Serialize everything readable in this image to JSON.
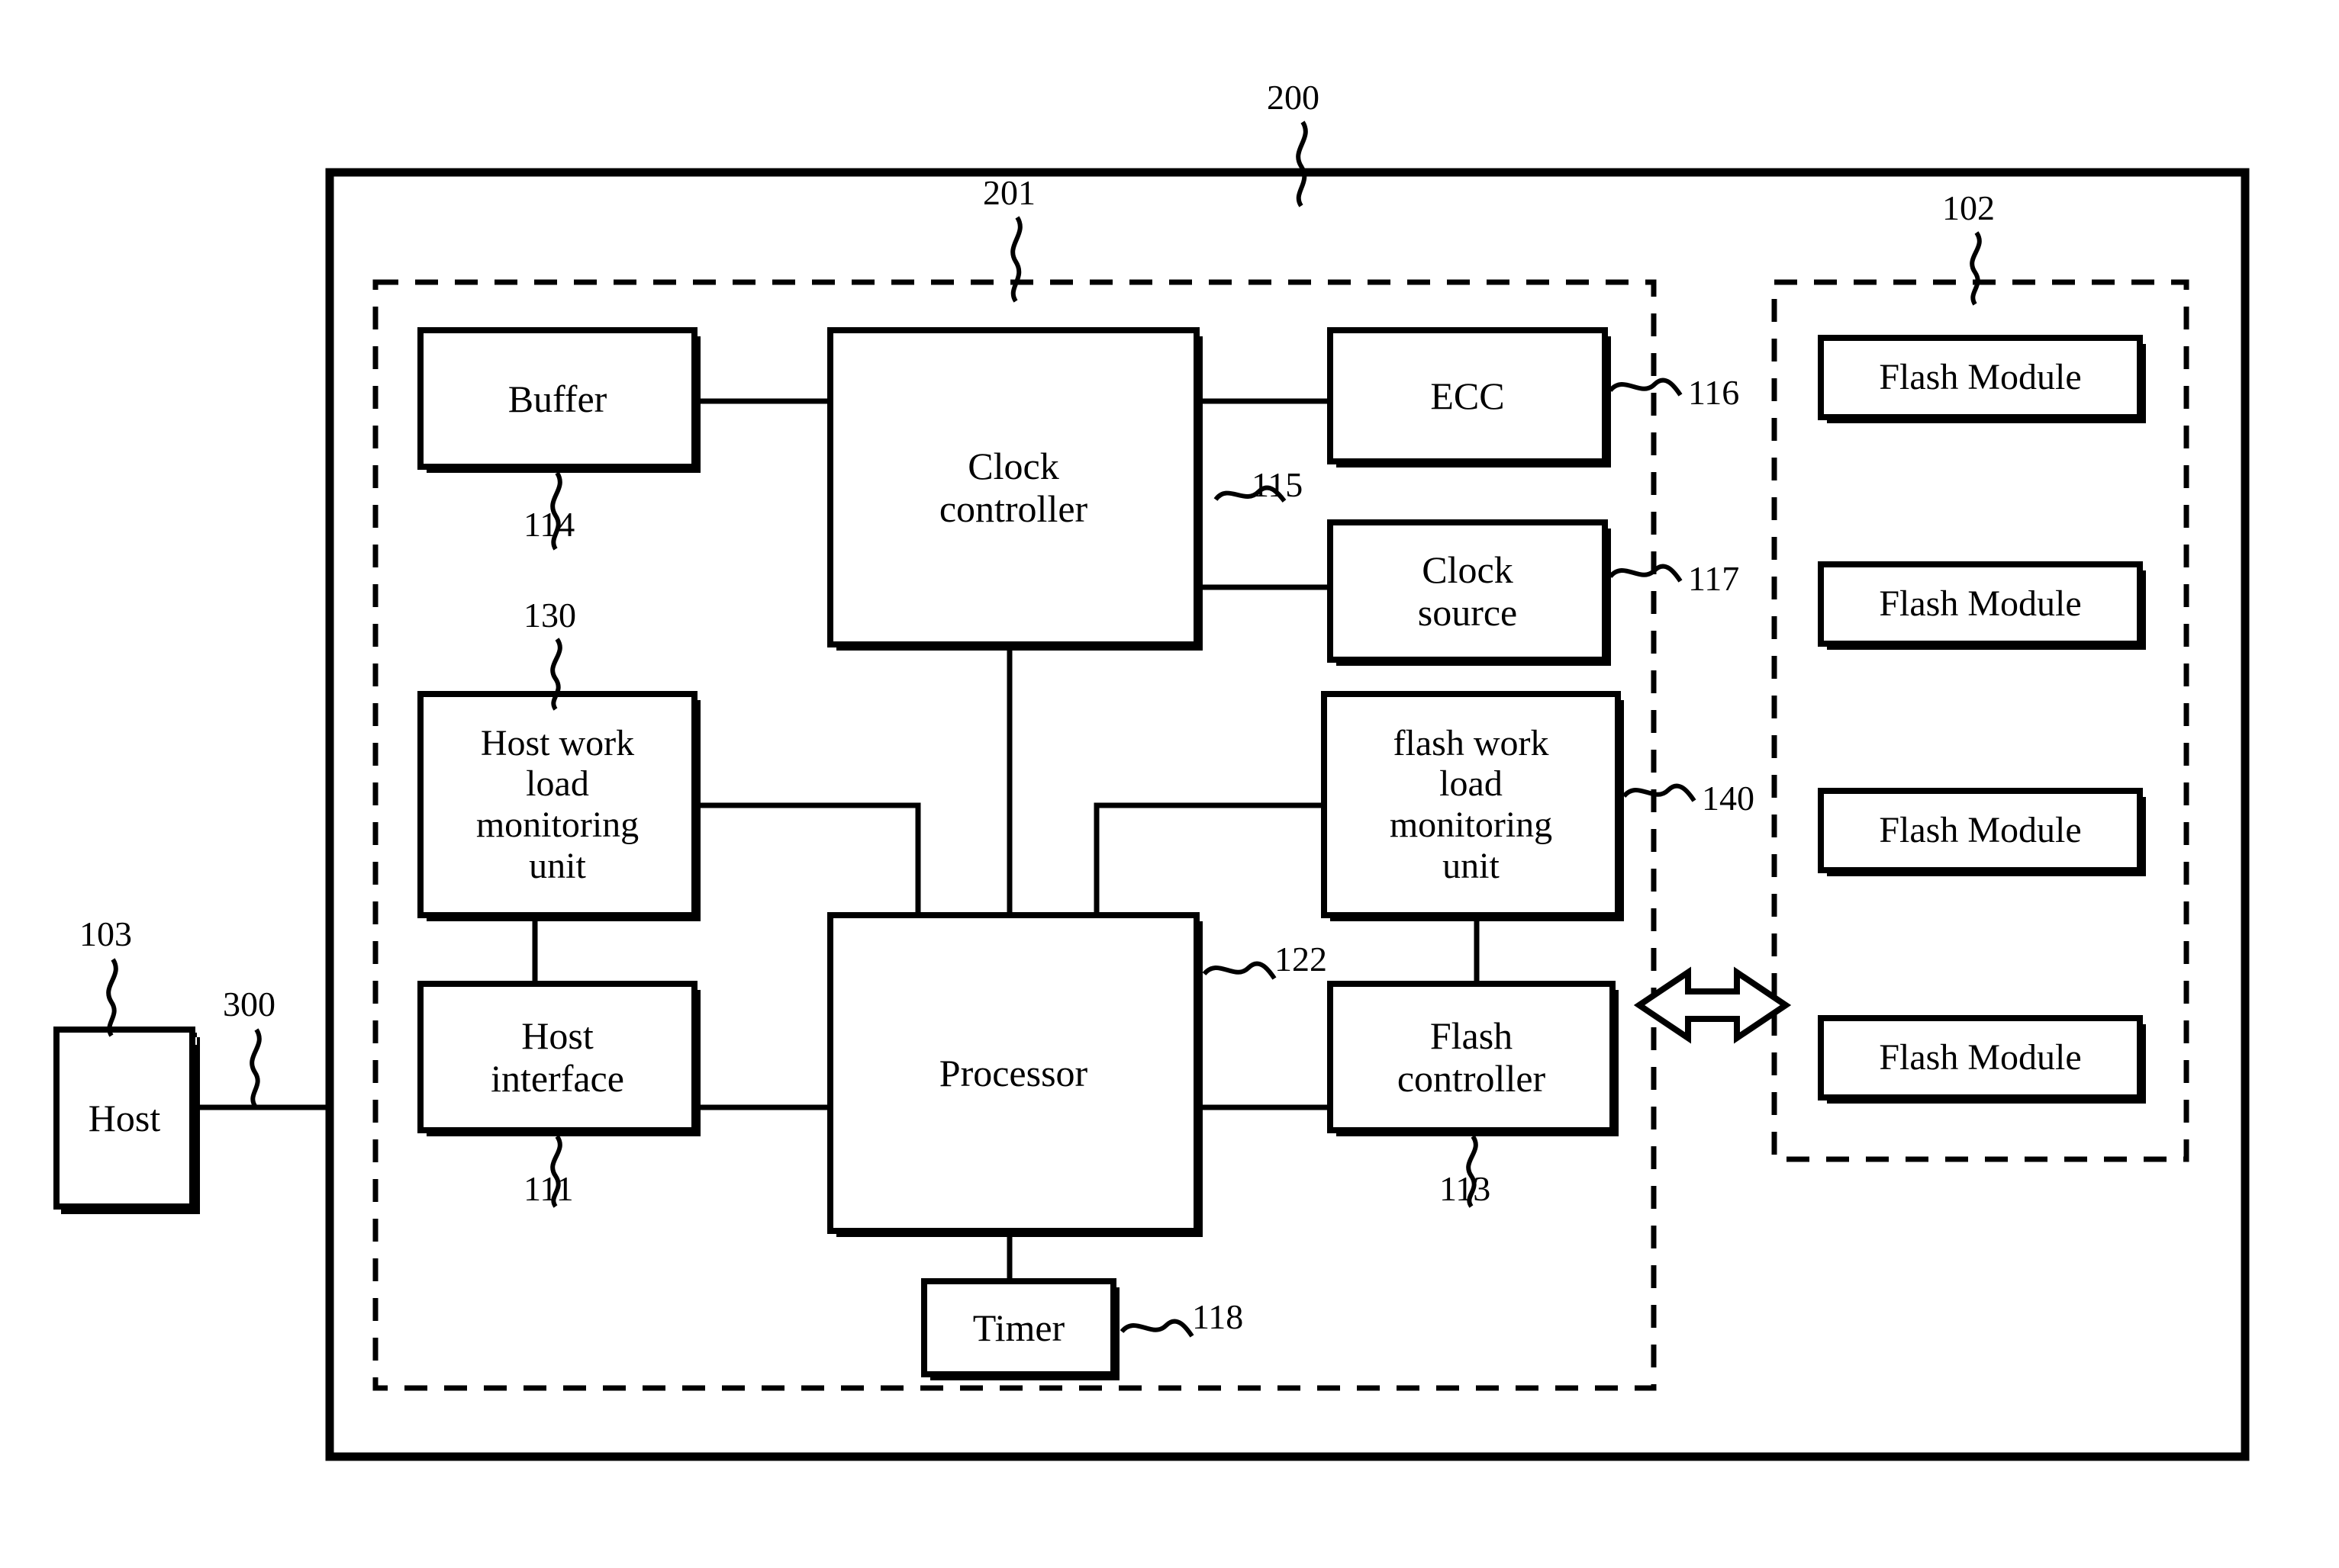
{
  "figure": {
    "type": "patent-block-diagram",
    "background_color": "#ffffff",
    "line_color": "#000000"
  },
  "blocks": {
    "host": {
      "label": "Host",
      "ref": "103"
    },
    "buffer": {
      "label": "Buffer",
      "ref": "114"
    },
    "clock_controller": {
      "label": "Clock\ncontroller",
      "ref": "115"
    },
    "ecc": {
      "label": "ECC",
      "ref": "116"
    },
    "clock_source": {
      "label": "Clock\nsource",
      "ref": "117"
    },
    "host_work_load_monitoring_unit": {
      "label": "Host work\nload\nmonitoring\nunit",
      "ref": "130"
    },
    "flash_work_load_monitoring_unit": {
      "label": "flash work\nload\nmonitoring\nunit",
      "ref": "140"
    },
    "host_interface": {
      "label": "Host\ninterface",
      "ref": "111"
    },
    "processor": {
      "label": "Processor",
      "ref": "122"
    },
    "timer": {
      "label": "Timer",
      "ref": "118"
    },
    "flash_controller": {
      "label": "Flash\ncontroller",
      "ref": "113"
    },
    "flash_modules": [
      {
        "label": "Flash  Module"
      },
      {
        "label": "Flash  Module"
      },
      {
        "label": "Flash  Module"
      },
      {
        "label": "Flash  Module"
      }
    ]
  },
  "containers": {
    "device": {
      "ref": "200",
      "style": "solid"
    },
    "controller": {
      "ref": "201",
      "style": "dashed"
    },
    "flash_memory": {
      "ref": "102",
      "style": "dashed"
    }
  },
  "connections": {
    "host_to_device_bus": {
      "ref": "300"
    }
  },
  "reference_numerals": [
    "200",
    "201",
    "102",
    "103",
    "300",
    "114",
    "115",
    "116",
    "117",
    "130",
    "140",
    "111",
    "122",
    "118",
    "113"
  ]
}
